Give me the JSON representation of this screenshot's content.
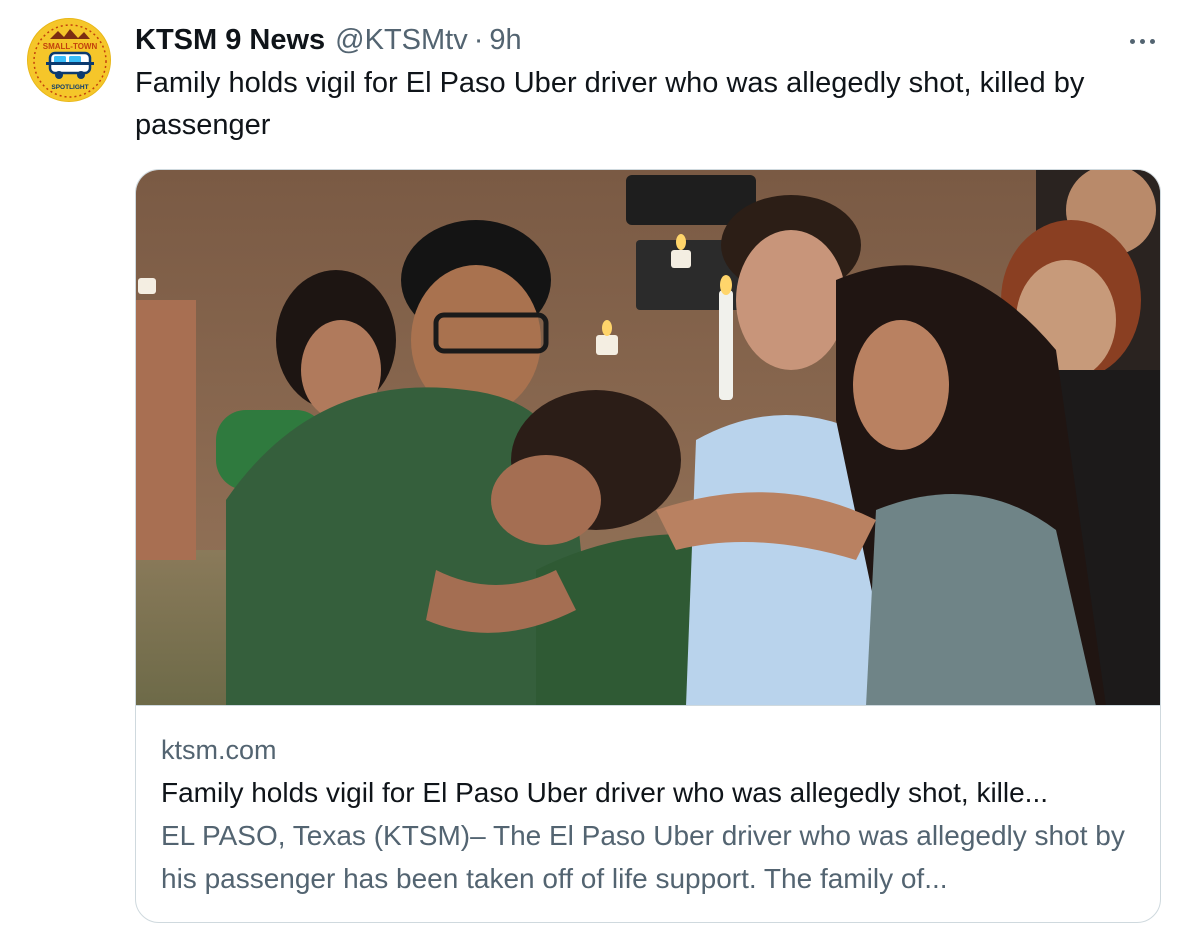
{
  "author": {
    "name": "KTSM 9 News",
    "handle": "@KTSMtv",
    "separator": "·",
    "time": "9h",
    "avatar": {
      "top_text": "SMALL-TOWN",
      "bottom_text": "SPOTLIGHT",
      "icon": "van-logo"
    }
  },
  "menu": {
    "icon": "more-horizontal-icon"
  },
  "tweet": {
    "text": "Family holds vigil for El Paso Uber driver who was allegedly shot, killed by passenger"
  },
  "card": {
    "image": {
      "description_icon": "photo",
      "kind": "news-photo"
    },
    "domain": "ktsm.com",
    "title": "Family holds vigil for El Paso Uber driver who was allegedly shot, kille...",
    "description": "EL PASO, Texas (KTSM)– The El Paso Uber driver who was allegedly shot by his passenger has been taken off of life support. The family of..."
  },
  "colors": {
    "text_primary": "#0f1419",
    "text_secondary": "#536471",
    "border": "#cfd9de",
    "avatar_bg": "#f5c62a"
  }
}
